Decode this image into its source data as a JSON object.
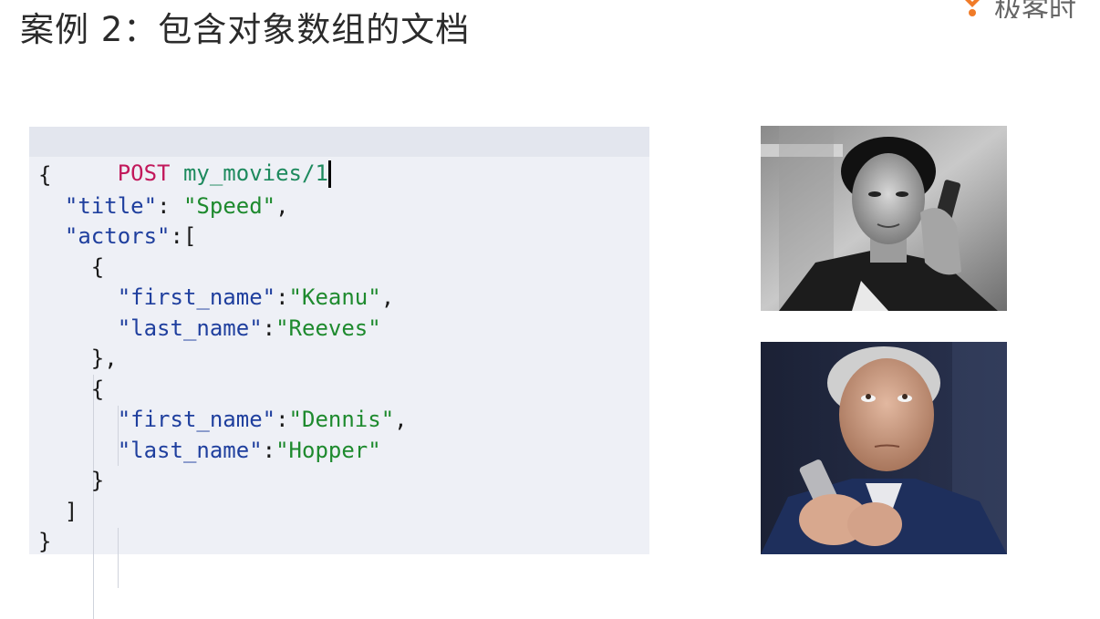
{
  "slide": {
    "title": "案例 2：包含对象数组的文档",
    "logo_text": "极客时"
  },
  "code_editor": {
    "method": "POST",
    "path": "my_movies/1",
    "lines": {
      "l1": "{",
      "l2_key": "\"title\"",
      "l2_sep": ": ",
      "l2_val": "\"Speed\"",
      "l2_end": ",",
      "l3_key": "\"actors\"",
      "l3_sep": ":[",
      "l4": "{",
      "l5_key": "\"first_name\"",
      "l5_sep": ":",
      "l5_val": "\"Keanu\"",
      "l5_end": ",",
      "l6_key": "\"last_name\"",
      "l6_sep": ":",
      "l6_val": "\"Reeves\"",
      "l7": "},",
      "l8": "{",
      "l9_key": "\"first_name\"",
      "l9_sep": ":",
      "l9_val": "\"Dennis\"",
      "l9_end": ",",
      "l10_key": "\"last_name\"",
      "l10_sep": ":",
      "l10_val": "\"Hopper\"",
      "l11": "}",
      "l12": "]",
      "l13": "}"
    }
  },
  "colors": {
    "method": "#c2185b",
    "path": "#1e8a5e",
    "key": "#1f3f9e",
    "string": "#1e8a2e",
    "panel_bg": "#eef0f6",
    "header_bg": "#e3e6ee",
    "logo": "#f07b28"
  },
  "images": [
    {
      "name": "keanu-reeves-photo",
      "description": "black and white portrait"
    },
    {
      "name": "dennis-hopper-photo",
      "description": "color portrait"
    }
  ]
}
